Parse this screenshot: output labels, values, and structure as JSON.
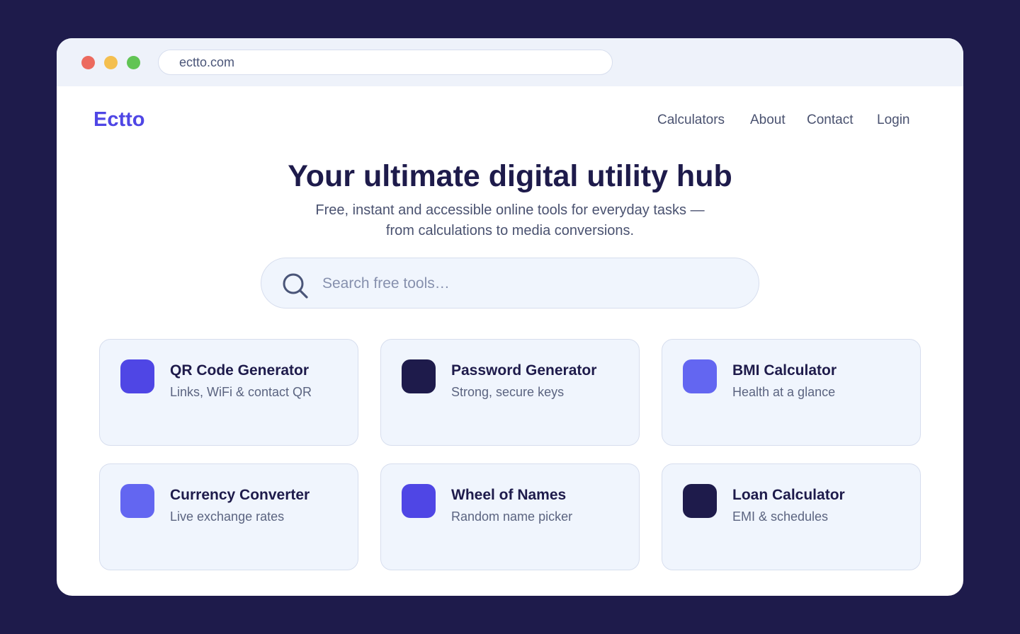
{
  "browser": {
    "url": "ectto.com",
    "traffic_light_colors": [
      "#ec6a5e",
      "#f4bf4f",
      "#61c454"
    ]
  },
  "site": {
    "logo": "Ectto",
    "logo_color": "#4f46e5",
    "nav": [
      "Calculators",
      "About",
      "Contact",
      "Login"
    ]
  },
  "hero": {
    "title": "Your ultimate digital utility hub",
    "subtitle_line1": "Free, instant and accessible online tools for everyday tasks —",
    "subtitle_line2": "from calculations to media conversions."
  },
  "search": {
    "placeholder": "Search free tools…",
    "value": "",
    "icon": "search-icon"
  },
  "tools": [
    {
      "title": "QR Code Generator",
      "desc": "Links, WiFi & contact QR",
      "color": "#4f46e5"
    },
    {
      "title": "Password Generator",
      "desc": "Strong, secure keys",
      "color": "#1e1b4b"
    },
    {
      "title": "BMI Calculator",
      "desc": "Health at a glance",
      "color": "#6366f1"
    },
    {
      "title": "Currency Converter",
      "desc": "Live exchange rates",
      "color": "#6366f1"
    },
    {
      "title": "Wheel of Names",
      "desc": "Random name picker",
      "color": "#4f46e5"
    },
    {
      "title": "Loan Calculator",
      "desc": "EMI & schedules",
      "color": "#1e1b4b"
    }
  ]
}
